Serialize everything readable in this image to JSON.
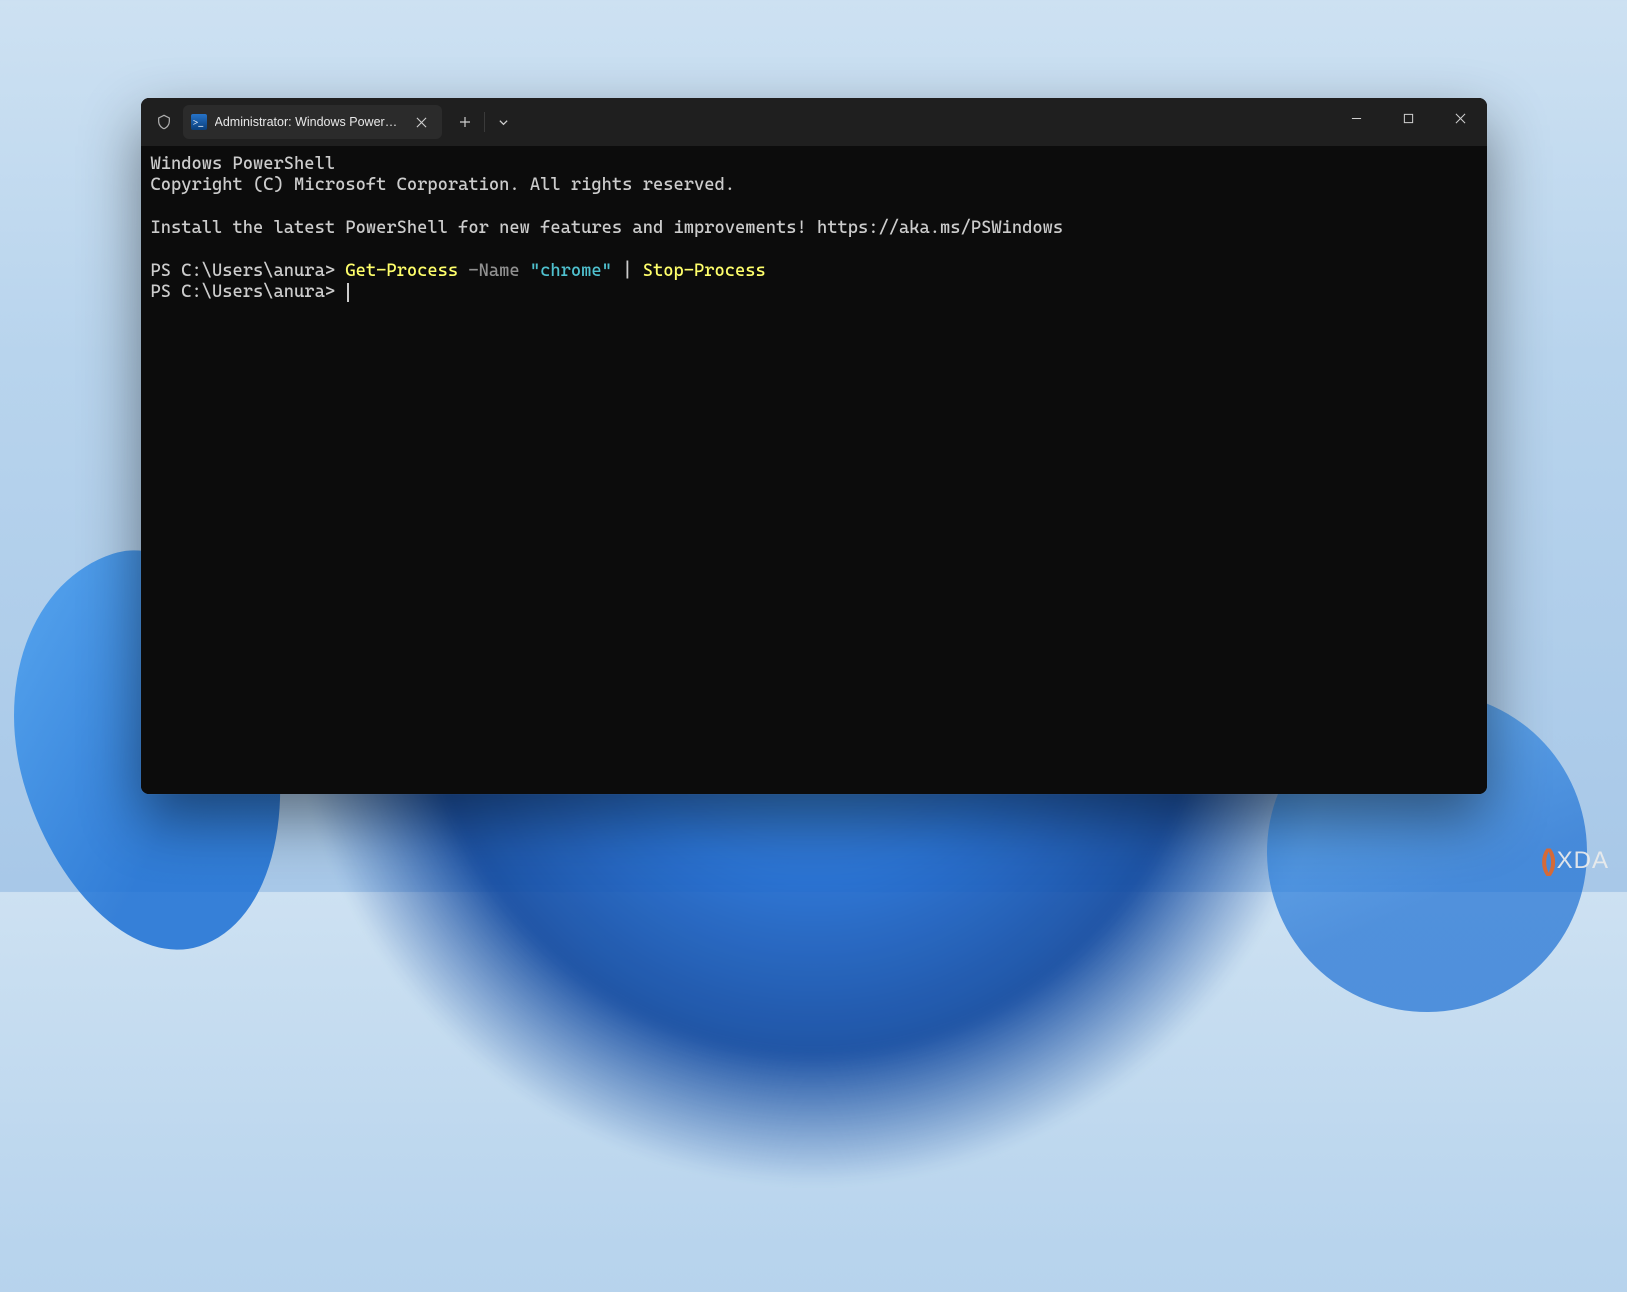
{
  "tab": {
    "title": "Administrator: Windows PowerShell"
  },
  "terminal": {
    "line1": "Windows PowerShell",
    "line2": "Copyright (C) Microsoft Corporation. All rights reserved.",
    "line3": "Install the latest PowerShell for new features and improvements! https://aka.ms/PSWindows",
    "prompt1": "PS C:\\Users\\anura> ",
    "cmd_getprocess": "Get-Process",
    "cmd_nameflag": " -Name ",
    "cmd_string": "\"chrome\"",
    "cmd_pipe": " | ",
    "cmd_stopprocess": "Stop-Process",
    "prompt2": "PS C:\\Users\\anura> "
  },
  "watermark": {
    "bracket": "()",
    "text": "XDA"
  }
}
